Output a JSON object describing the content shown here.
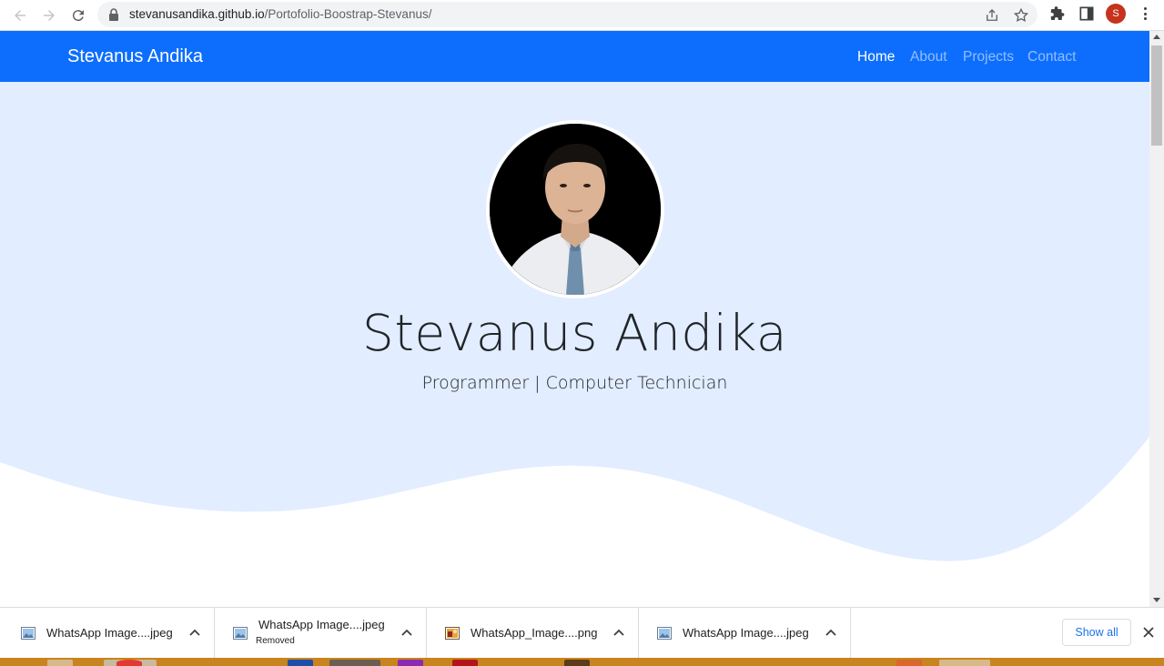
{
  "browser": {
    "url_host": "stevanusandika.github.io",
    "url_path": "/Portofolio-Boostrap-Stevanus/",
    "profile_initial": "S",
    "icons": [
      "back-icon",
      "forward-icon",
      "reload-icon",
      "lock-icon",
      "share-icon",
      "star-icon",
      "extensions-icon",
      "side-panel-icon",
      "menu-icon"
    ]
  },
  "navbar": {
    "brand": "Stevanus Andika",
    "links": [
      {
        "label": "Home",
        "active": true
      },
      {
        "label": "About",
        "active": false
      },
      {
        "label": "Projects",
        "active": false
      },
      {
        "label": "Contact",
        "active": false
      }
    ]
  },
  "hero": {
    "name": "Stevanus Andika",
    "subtitle": "Programmer | Computer Technician"
  },
  "downloads": {
    "items": [
      {
        "name": "WhatsApp Image....jpeg",
        "status": ""
      },
      {
        "name": "WhatsApp Image....jpeg",
        "status": "Removed"
      },
      {
        "name": "WhatsApp_Image....png",
        "status": ""
      },
      {
        "name": "WhatsApp Image....jpeg",
        "status": ""
      }
    ],
    "show_all": "Show all"
  },
  "colors": {
    "navbar": "#0d6efd",
    "hero_bg": "#e2edff",
    "link_accent": "#1a73e8"
  }
}
